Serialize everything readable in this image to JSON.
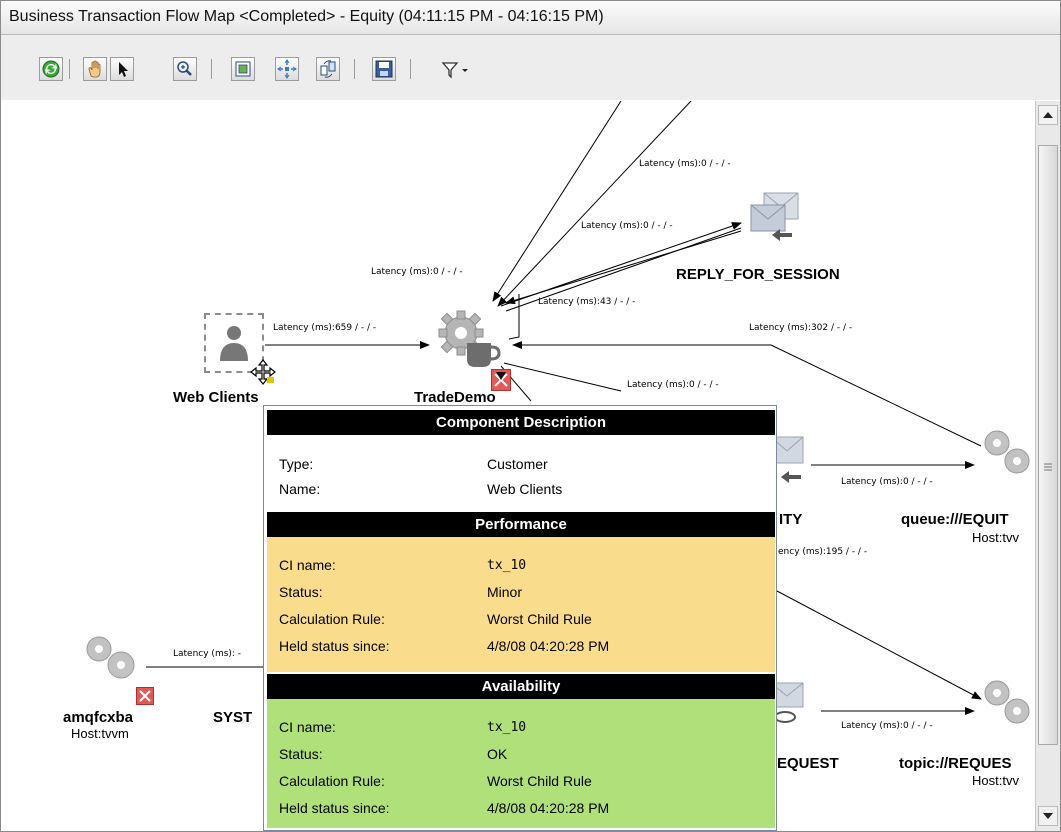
{
  "window": {
    "title": "Business Transaction Flow Map <Completed> - Equity (04:11:15 PM - 04:16:15 PM)"
  },
  "toolbar": {
    "buttons": [
      {
        "name": "refresh-icon"
      },
      {
        "name": "pan-hand-icon"
      },
      {
        "name": "select-pointer-icon"
      },
      {
        "name": "zoom-in-icon"
      },
      {
        "name": "fit-to-window-icon"
      },
      {
        "name": "layout-icon"
      },
      {
        "name": "sync-icon"
      },
      {
        "name": "save-icon"
      },
      {
        "name": "filter-icon"
      }
    ]
  },
  "map": {
    "nodes": {
      "web_clients": {
        "label": "Web Clients"
      },
      "tradedemo": {
        "label": "TradeDemo"
      },
      "reply_for_session": {
        "label": "REPLY_FOR_SESSION"
      },
      "queue_equity": {
        "label": "queue:///EQUIT",
        "host": "Host:tvv"
      },
      "equity_partial": {
        "label": "ITY"
      },
      "amqfcxba": {
        "label": "amqfcxba",
        "host": "Host:tvvm"
      },
      "syst": {
        "label": "SYST"
      },
      "request_partial": {
        "label": "EQUEST"
      },
      "topic_request": {
        "label": "topic://REQUES",
        "host": "Host:tvv"
      }
    },
    "edges": {
      "e1": "Latency (ms):0 / - / -",
      "e2": "Latency (ms):0 / - / -",
      "e3": "Latency (ms):0 / - / -",
      "e4": "Latency (ms):43 / - / -",
      "e5": "Latency (ms):659 / - / -",
      "e6": "Latency (ms):302 / - / -",
      "e7": "Latency (ms):0 / - / -",
      "e8": "Latency (ms):0 / - / -",
      "e9": "ency (ms):195 / - / -",
      "e10": "Latency (ms): -",
      "e11": "Latency (ms):0 / - / -"
    }
  },
  "tooltip": {
    "component_header": "Component Description",
    "type_label": "Type:",
    "type_value": "Customer",
    "name_label": "Name:",
    "name_value": "Web Clients",
    "performance_header": "Performance",
    "perf": {
      "ci_label": "CI name:",
      "ci_value": "tx_10",
      "status_label": "Status:",
      "status_value": "Minor",
      "rule_label": "Calculation Rule:",
      "rule_value": "Worst Child Rule",
      "held_label": "Held status since:",
      "held_value": "4/8/08 04:20:28 PM",
      "color": "#fadd8c"
    },
    "availability_header": "Availability",
    "avail": {
      "ci_label": "CI name:",
      "ci_value": "tx_10",
      "status_label": "Status:",
      "status_value": "OK",
      "rule_label": "Calculation Rule:",
      "rule_value": "Worst Child Rule",
      "held_label": "Held status since:",
      "held_value": "4/8/08 04:20:28 PM",
      "color": "#b0e07a"
    }
  }
}
